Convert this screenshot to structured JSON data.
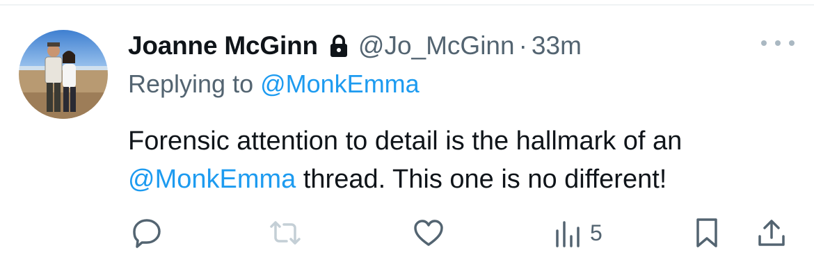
{
  "tweet": {
    "display_name": "Joanne McGinn",
    "handle": "@Jo_McGinn",
    "separator": "·",
    "time": "33m",
    "replying_prefix": "Replying to ",
    "replying_to": "@MonkEmma",
    "text_part1": "Forensic attention to detail is the hallmark of an",
    "text_mention": "@MonkEmma",
    "text_part2": " thread. This one is no different!",
    "views": "5"
  },
  "icons": {
    "protected": "lock-icon",
    "more": "more-icon",
    "reply": "reply-icon",
    "retweet": "retweet-icon",
    "like": "like-icon",
    "views": "views-icon",
    "bookmark": "bookmark-icon",
    "share": "share-icon"
  },
  "colors": {
    "link": "#1d9bf0",
    "secondary_text": "#536471",
    "primary_text": "#0f1419",
    "disabled_icon": "#c4cfd6"
  }
}
